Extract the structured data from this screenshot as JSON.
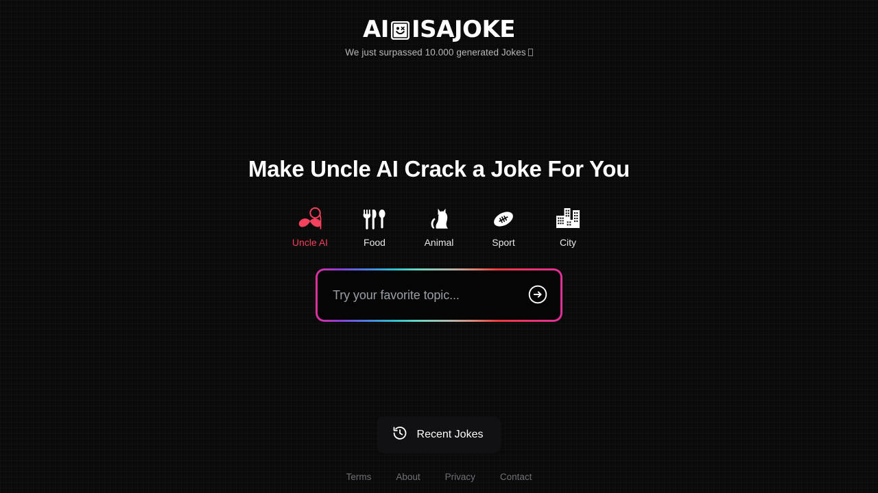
{
  "brand": {
    "logo_prefix": "AI",
    "logo_suffix": "ISAJOKE",
    "logo_mark_icon": "smiley-face-icon",
    "tagline": "We just surpassed 10.000 generated Jokes",
    "tagline_trailing_glyph": "missing-emoji-glyph"
  },
  "hero": {
    "headline": "Make Uncle AI Crack a Joke For You"
  },
  "categories": [
    {
      "label": "Uncle AI",
      "icon": "mustache-monocle-icon",
      "active": true
    },
    {
      "label": "Food",
      "icon": "fork-knife-spoon-icon",
      "active": false
    },
    {
      "label": "Animal",
      "icon": "cat-icon",
      "active": false
    },
    {
      "label": "Sport",
      "icon": "football-icon",
      "active": false
    },
    {
      "label": "City",
      "icon": "buildings-icon",
      "active": false
    }
  ],
  "search": {
    "value": "",
    "placeholder": "Try your favorite topic...",
    "submit_icon": "arrow-right-circle-icon"
  },
  "recent": {
    "label": "Recent Jokes",
    "icon": "history-clock-icon"
  },
  "footer": {
    "links": [
      {
        "label": "Terms"
      },
      {
        "label": "About"
      },
      {
        "label": "Privacy"
      },
      {
        "label": "Contact"
      }
    ]
  },
  "colors": {
    "background": "#0a0a0a",
    "accent_pink": "#f4415e",
    "text_primary": "#ffffff",
    "text_muted": "#b9b9bd",
    "footer_link": "#6f7279",
    "placeholder": "#9aa0a8"
  }
}
